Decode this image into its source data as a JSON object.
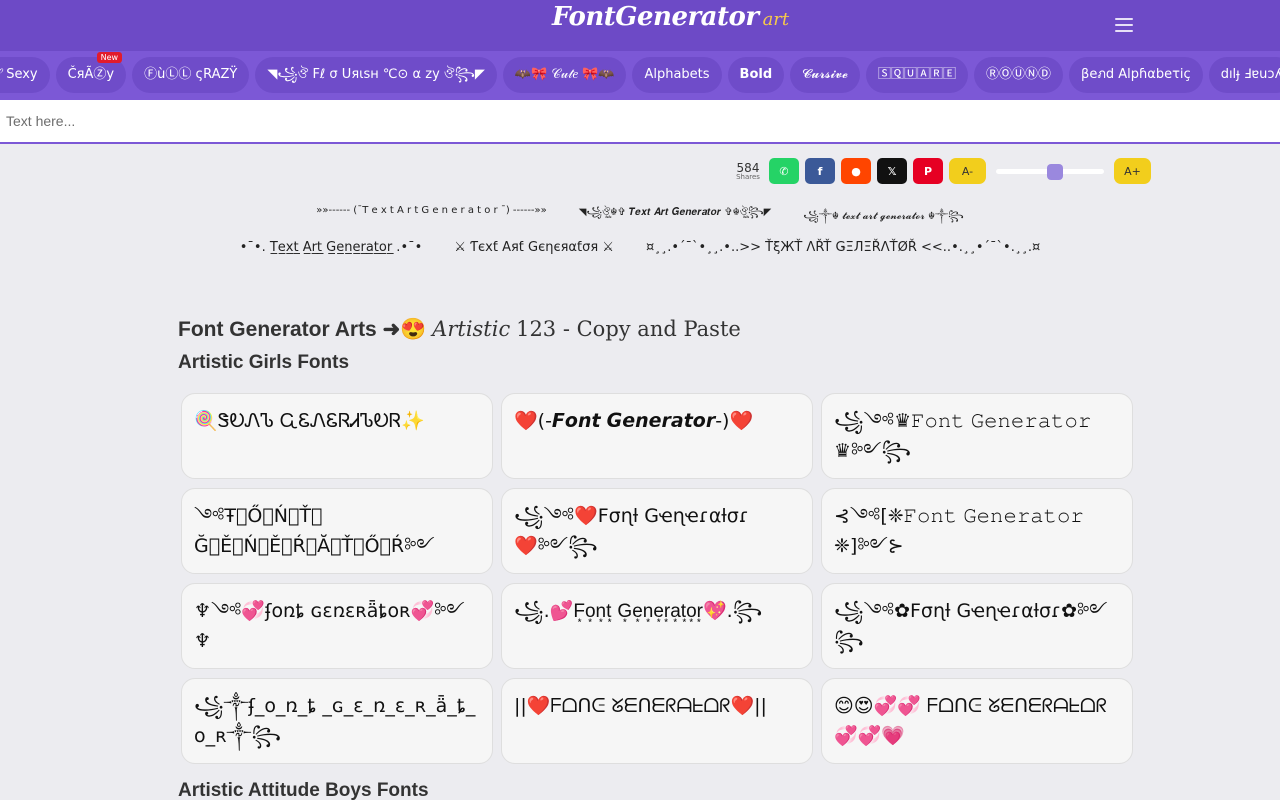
{
  "header": {
    "logo_main": "FontGenerator",
    "logo_sub": "art"
  },
  "nav": {
    "items": [
      {
        "label": "𝒮 Sexy",
        "badge": ""
      },
      {
        "label": "ČяÃⓏу",
        "badge": "New"
      },
      {
        "label": "ⒻùⓁⓁ ςRAZŸ",
        "badge": ""
      },
      {
        "label": "◥꧁ঔ Fℓ σ Uяιѕн ℃⊙ α zу ঔ꧂◤",
        "badge": ""
      },
      {
        "label": "🦇🎀 𝒞𝓊𝓉𝑒 🎀🦇",
        "badge": ""
      },
      {
        "label": "Alphabets",
        "badge": ""
      },
      {
        "label": "Bold",
        "badge": ""
      },
      {
        "label": "𝓒𝓾𝓻𝓼𝓲𝓿𝓮",
        "badge": ""
      },
      {
        "label": "🅂🅀🅄🄰🅁🄴",
        "badge": ""
      },
      {
        "label": "ⓇⓄⓊⓃⒹ",
        "badge": ""
      },
      {
        "label": "βeภd Alpɦαbeτiç",
        "badge": ""
      },
      {
        "label": "dılɟ Ⅎɐuɔʎ",
        "badge": ""
      }
    ]
  },
  "search": {
    "placeholder": "Text here...",
    "value": ""
  },
  "share": {
    "count": "584",
    "count_label": "Shares",
    "buttons": [
      {
        "name": "whatsapp",
        "label": "✆",
        "color": "#25d366"
      },
      {
        "name": "facebook",
        "label": "f",
        "color": "#3b5998"
      },
      {
        "name": "reddit",
        "label": "●",
        "color": "#ff4500"
      },
      {
        "name": "x",
        "label": "𝕏",
        "color": "#111111"
      },
      {
        "name": "pinterest",
        "label": "P",
        "color": "#e60023"
      }
    ],
    "font_minus": "A-",
    "font_plus": "A+",
    "font_size_level": 0.55
  },
  "preview_links": {
    "row1": [
      "»»------ (¯T e x t  A r t  G e n e r a t o r ¯) ------»»",
      "◥꧁ঔৣ☬✞ 𝑻𝒆𝒙𝒕 𝑨𝒓𝒕 𝑮𝒆𝒏𝒆𝒓𝒂𝒕𝒐𝒓 ✞☬ঔৣ꧂◤",
      "꧁༒☬ 𝓽𝓮𝔁𝓽 𝓪𝓻𝓽 𝓰𝓮𝓷𝓮𝓻𝓪𝓽𝓸𝓻 ☬༒꧂"
    ],
    "row2": [
      "•¯•. T̲e̲x̲t̲ A̲r̲t̲ G̲e̲n̲e̲r̲a̲t̲o̲r̲ .•¯•",
      "⚔ Ƭєxƭ Aяƭ Gєηєяαƭσя ⚔",
      "¤¸¸.•´¯`•¸¸.•..>> ŤξЖŤ ΛŘŤ ǤΞЛΞŘΛŤØŘ <<..•.¸¸•´¯`•.¸¸.¤"
    ]
  },
  "main": {
    "heading_prefix": "Font Generator Arts ➜😍",
    "heading_art": "Artistic",
    "heading_suffix": "123 - Copy and Paste",
    "section1_title": "Artistic Girls Fonts",
    "section2_title": "Artistic Attitude Boys Fonts",
    "cards": [
      "🍭ᏕᎧᏁᏖ ᏩᏋᏁᏋᏒᏗᏖᎧᏒ✨",
      "❤️(-𝙁𝙤𝙣𝙩 𝙂𝙚𝙣𝙚𝙧𝙖𝙩𝙤𝙧-)❤️",
      "꧁༺♛𝙵𝚘𝚗𝚝 𝙶𝚎𝚗𝚎𝚛𝚊𝚝𝚘𝚛♛༻꧂",
      "༺Ŧ⃟Ő⃟Ń⃟Ť⃟ Ğ⃟Ě⃟Ń⃟Ě⃟Ŕ⃟Ă⃟Ť⃟Ő⃟Ŕ༻",
      "꧁༺❤️Fσɳƚ Gҽɳҽɾαƚσɾ❤️༻꧂",
      "⊰༺[❈𝙵𝚘𝚗𝚝 𝙶𝚎𝚗𝚎𝚛𝚊𝚝𝚘𝚛❈]༻⊱",
      "♆༺💞ʄօռȶ ɢɛռɛʀǟȶօʀ💞༻♆",
      "꧁.💕F͙o͙n͙t͙ G͙e͙n͙e͙r͙a͙t͙o͙r͙💖.꧂",
      "꧁༺✿Fσɳƚ Gҽɳҽɾαƚσɾ✿༻꧂",
      "꧁༒ʄ_օ_ռ_ȶ _ɢ_ɛ_ռ_ɛ_ʀ_ǟ_ȶ_օ_ʀ༒꧂",
      "||❤️ᖴᗝᑎᕮ ᘜᗴᑎᗴᖇᗩᖶᗝᖇ❤️||",
      "😊😍💞💞 ᖴᗝᑎᕮ ᘜᗴᑎᗴᖇᗩᖶᗝᖇ 💞💞💗"
    ]
  }
}
